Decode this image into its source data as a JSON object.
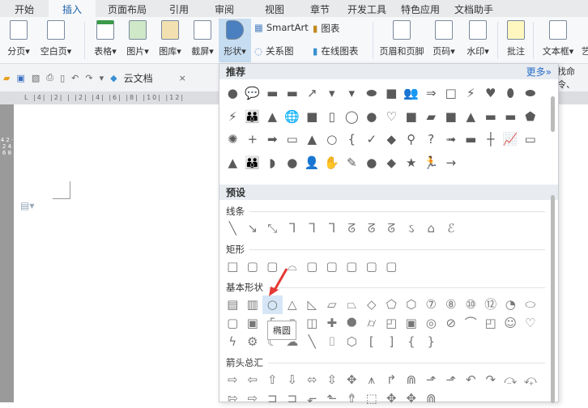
{
  "tabs": [
    "开始",
    "插入",
    "页面布局",
    "引用",
    "审阅",
    "视图",
    "章节",
    "开发工具",
    "特色应用",
    "文档助手"
  ],
  "ribbon": {
    "page_break": "分页",
    "blank_page": "空白页",
    "table": "表格",
    "picture": "图片",
    "gallery": "图库",
    "screenshot": "截屏",
    "shapes": "形状",
    "smartart": "SmartArt",
    "chart": "图表",
    "relation": "关系图",
    "online_chart": "在线图表",
    "header_footer": "页眉和页脚",
    "page_num": "页码",
    "watermark": "水印",
    "comment": "批注",
    "textbox": "文本框",
    "art": "艺"
  },
  "qat": {
    "cloud_doc": "云文档",
    "close": "×",
    "cmd": "找命令、"
  },
  "ruler": "L |4| |2| |  |2| |4| |6| |8| |10| |12|",
  "panel": {
    "recommended": "推荐",
    "more": "更多»",
    "presets": "预设",
    "rec_icons": [
      "●",
      "💬",
      "▬",
      "▬",
      "↗",
      "▾",
      "▾",
      "⬬",
      "■",
      "👥",
      "⇒",
      "□",
      "⚡",
      "♥",
      "⬮",
      "⬬",
      "⚡",
      "👪",
      "▲",
      "🌐",
      "■",
      "▯",
      "◯",
      "●",
      "♡",
      "■",
      "▰",
      "■",
      "▲",
      "▬",
      "▬",
      "⬟",
      "✺",
      "+",
      "➡",
      "▭",
      "▲",
      "○",
      "{",
      "✓",
      "◆",
      "⚲",
      "?",
      "➟",
      "▬",
      "┼",
      "📈",
      "▭",
      "▲",
      "👪",
      "◗",
      "●",
      "👤",
      "✋",
      "✎",
      "●",
      "◆",
      "★",
      "🏃",
      "→"
    ],
    "categories": [
      {
        "label": "线条",
        "icons": [
          "╲",
          "↘",
          "⤡",
          "ᒣ",
          "ᒣ",
          "ᒣ",
          "ᘔ",
          "ᘔ",
          "ᘔ",
          "ઽ",
          "⌂",
          "ℰ"
        ]
      },
      {
        "label": "矩形",
        "icons": [
          "□",
          "▢",
          "▢",
          "⌓",
          "▢",
          "▢",
          "▢",
          "▢",
          "▢"
        ]
      },
      {
        "label": "基本形状",
        "icons": [
          "▤",
          "▥",
          "○",
          "△",
          "◺",
          "▱",
          "⏢",
          "◇",
          "⬠",
          "⬡",
          "⑦",
          "⑧",
          "⑩",
          "⑫",
          "◔",
          "⬭",
          "▢",
          "▣",
          "⌜",
          "▯",
          "◫",
          "✚",
          "⯃",
          "⌭",
          "◰",
          "▣",
          "◎",
          "⊘",
          "⌒",
          "◰",
          "☺",
          "♡",
          "ϟ",
          "⚙",
          "☾",
          "☁",
          "╲",
          "⌷",
          "⬡",
          "[",
          "]",
          "{",
          "}"
        ]
      },
      {
        "label": "箭头总汇",
        "icons": [
          "⇨",
          "⇦",
          "⇧",
          "⇩",
          "⬄",
          "⇳",
          "✥",
          "⩚",
          "↱",
          "⋒",
          "⬏",
          "⬏",
          "↶",
          "↷",
          "⤼",
          "⤽",
          "⇰",
          "⇨",
          "⊐",
          "⊐",
          "⬐",
          "⬑",
          "⇮",
          "⬚",
          "✥",
          "✥",
          "⋒"
        ]
      }
    ],
    "tooltip": "椭圆"
  },
  "colors": {
    "accent": "#1c5fa8",
    "arrow": "#e53935"
  }
}
